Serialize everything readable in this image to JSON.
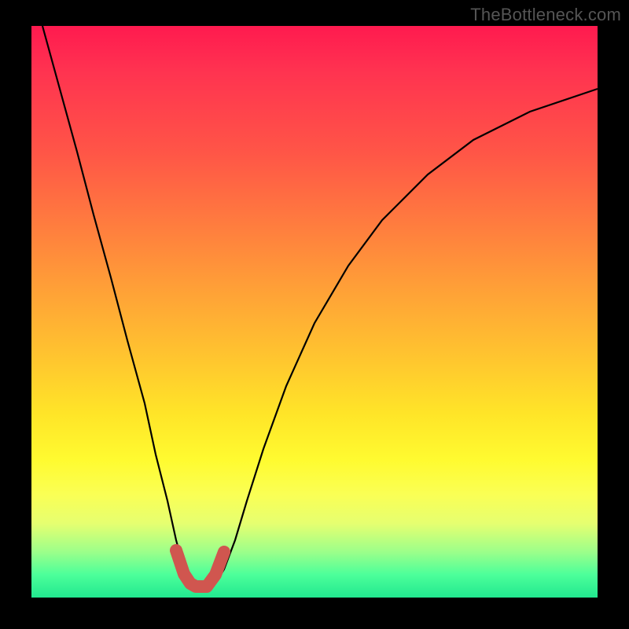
{
  "watermark": "TheBottleneck.com",
  "chart_data": {
    "type": "line",
    "title": "",
    "xlabel": "",
    "ylabel": "",
    "xlim": [
      0,
      100
    ],
    "ylim": [
      0,
      100
    ],
    "grid": false,
    "legend": false,
    "series": [
      {
        "name": "bottleneck-curve",
        "color": "#000000",
        "x": [
          2,
          5,
          8,
          11,
          14,
          17,
          20,
          22,
          24,
          25.5,
          27,
          28,
          29,
          30,
          31,
          32.5,
          34,
          36,
          38,
          41,
          45,
          50,
          56,
          62,
          70,
          78,
          88,
          100
        ],
        "y": [
          100,
          89,
          78,
          67,
          56,
          45,
          34,
          25,
          17,
          10,
          5,
          2.5,
          1.8,
          1.5,
          1.8,
          2.5,
          5,
          10,
          17,
          26,
          37,
          48,
          58,
          66,
          74,
          80,
          85,
          89
        ]
      },
      {
        "name": "optimal-region-marker",
        "color": "#d0564f",
        "x": [
          25.5,
          27,
          28,
          29,
          30,
          31,
          32.5,
          34
        ],
        "y": [
          8,
          4,
          2.5,
          2,
          2,
          2.5,
          4,
          8
        ]
      }
    ],
    "annotations": []
  }
}
